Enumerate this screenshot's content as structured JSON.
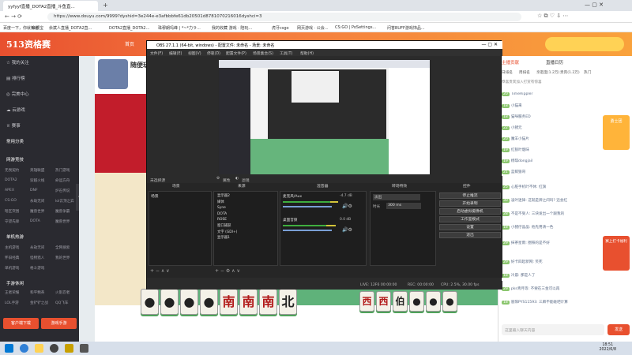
{
  "browser": {
    "tabs": [
      {
        "label": "yyfyyf直播_DOTA2直播_斗鱼直...",
        "active": true
      },
      {
        "label": "+",
        "active": false
      }
    ],
    "url": "https://www.douyu.com/9999?dyshid=3e244e-e3afbbbfe61db20501d8781070216016dyshci=3",
    "bookmarks": [
      "百度一下，你就知道",
      "余额宝",
      "余斌人直播_DOTA2直...",
      "DOTA2直播_DOTA2...",
      "珠穆朗玛峰 | *~*力ラ...",
      "我的收藏 游戏 · 陪玩...",
      "虎牙csgo",
      "网页游戏 · 公会...",
      "CS:GO | PoSettings...",
      "问答BUFF游戏饰品..."
    ]
  },
  "douyu": {
    "logo": "513资格赛",
    "nav_first": "首页",
    "sidebar": {
      "items": [
        "我的关注",
        "排行榜",
        "完美中心",
        "云游戏",
        "赛事"
      ],
      "section_recommend": "常用分类",
      "section_games": "网游竞技",
      "game_grid": [
        "无畏契约",
        "英雄联盟",
        "热门游戏",
        "DOTA2",
        "穿越火线",
        "命运方舟",
        "APEX",
        "DNF",
        "炉石传说",
        "CS:GO",
        "永劫无间",
        "lol云顶之弈",
        "暗区突围",
        "魔兽世界",
        "魔兽争霸",
        "守望先锋",
        "DOTA",
        "魔兽世界"
      ],
      "section_single": "单机热游",
      "single_grid": [
        "主机游戏",
        "永劫无间",
        "全网搜索",
        "怀旧经典",
        "怪物猎人",
        "我的世界",
        "单机游戏",
        "格斗游戏"
      ],
      "section_mobile": "手游休闲",
      "mobile_grid": [
        "王者荣耀",
        "和平精英",
        "火影忍者",
        "LOL手游",
        "金铲铲之战",
        "QQ飞车"
      ],
      "buttons": [
        "客户端下载",
        "游戏手游"
      ]
    },
    "streamer_badge": "随便玩",
    "chat": {
      "tabs": [
        "主播贡献",
        "直播日历"
      ],
      "subtabs": [
        "日排名",
        "周排名",
        "亲密度(1.2万)",
        "贵宾(1.2万)",
        "热门"
      ],
      "notice": "恭喜贵宾加入打赏有惊喜",
      "messages": [
        {
          "level": "20",
          "text": "TimeRippler"
        },
        {
          "level": "18",
          "text": "小猫来"
        },
        {
          "level": "18",
          "text": "猫咪服务ED"
        },
        {
          "level": "22",
          "text": "小猪元"
        },
        {
          "level": "20",
          "text": "魔羊小猫片"
        },
        {
          "level": "19",
          "text": "红狼叶烟味"
        },
        {
          "level": "19",
          "text": "杨琪dongjail"
        },
        {
          "level": "21",
          "text": "蓝鲸狼哥"
        },
        {
          "level": "25",
          "text": "心脏手机叶不休:  红旗"
        },
        {
          "level": "30",
          "text": "凌叶迷锋: 这就是牌之间吗? 迈会红"
        },
        {
          "level": "28",
          "text": "不是不受人: 三块发出一个跟我的"
        },
        {
          "level": "18",
          "text": "小猪仔晶晶: 他先用清一色"
        },
        {
          "level": "29",
          "text": "抹茶星雨: 圈铁的是不好"
        },
        {
          "level": "29",
          "text": "好卡四起新网: 笑死"
        },
        {
          "level": "18",
          "text": "冷晨: 那是人了"
        },
        {
          "level": "29",
          "text": "pks青月等: 不要在三金可以再"
        },
        {
          "level": "18",
          "text": "丽阳PYS11593: 三麻不能碰吧计算"
        }
      ],
      "input_placeholder": "这里输入聊天内容",
      "send": "发送"
    },
    "promo": [
      "勇士团",
      "赛上打卡福利"
    ]
  },
  "obs": {
    "title": "OBS 27.1.1 (64-bit, windows) - 配置文件: 未命名 - 场景: 未命名",
    "menu": [
      "文件(F)",
      "编辑(E)",
      "视图(V)",
      "停靠(D)",
      "配置文件(P)",
      "场景集合(S)",
      "工具(T)",
      "帮助(H)"
    ],
    "source_bar": "未选择源",
    "props_btn": "属性",
    "filter_btn": "滤镜",
    "docks": [
      "场景",
      "来源",
      "混音器",
      "转场特效",
      "控件"
    ],
    "scene_item": "场景",
    "sources": [
      "显示器2",
      "媒体",
      "Syne",
      "DOTA",
      "ROSE",
      "窗口捕获",
      "文字 (GDI+)",
      "显示器1"
    ],
    "mixer": [
      {
        "name": "麦克风/Aux",
        "db": "-4.7 dB"
      },
      {
        "name": "桌面音频",
        "db": "0.0 dB"
      }
    ],
    "transition": {
      "type": "淡出",
      "duration_label": "时长",
      "duration": "300 ms"
    },
    "controls": [
      "停止推流",
      "开始录制",
      "启动虚拟摄像机",
      "工作室模式",
      "设置",
      "退出"
    ],
    "status": {
      "dropped": "LIVE: 12F6 00:00:00",
      "rec": "REC: 00:00:00",
      "cpu": "CPU: 2.5%, 30.00 fps"
    }
  },
  "tiles": [
    "●",
    "●",
    "●",
    "●",
    "南",
    "南",
    "南",
    "北"
  ],
  "right_tiles": [
    "西",
    "西",
    "伯",
    "●",
    "●",
    "●"
  ],
  "taskbar": {
    "time": "18:51",
    "date": "2022/6/8"
  }
}
